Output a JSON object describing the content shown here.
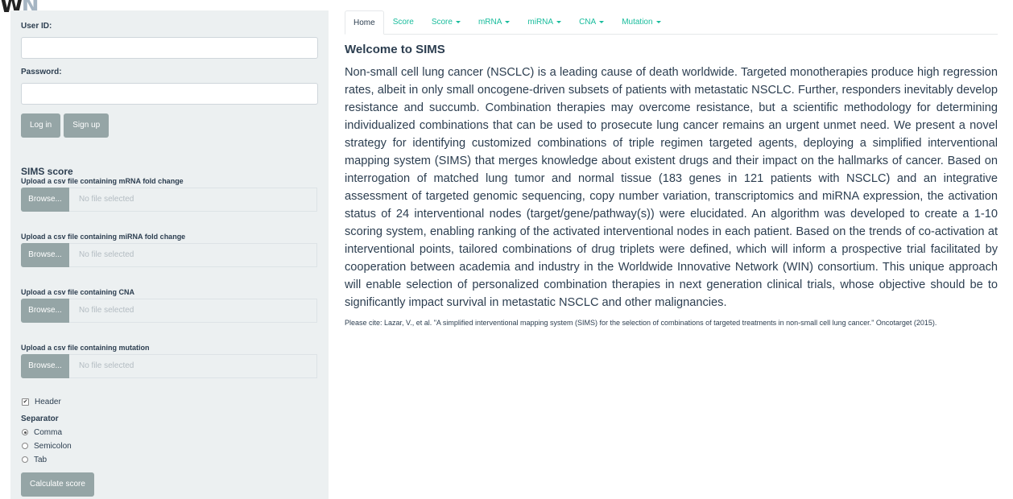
{
  "logo": {
    "letter1": "W",
    "letter2": "N"
  },
  "login": {
    "user_label": "User ID:",
    "user_value": "",
    "password_label": "Password:",
    "password_value": "",
    "login_button": "Log in",
    "signup_button": "Sign up"
  },
  "sims": {
    "section_title": "SIMS score",
    "uploads": [
      {
        "label": "Upload a csv file containing mRNA fold change",
        "browse": "Browse...",
        "file": "No file selected"
      },
      {
        "label": "Upload a csv file containing miRNA fold change",
        "browse": "Browse...",
        "file": "No file selected"
      },
      {
        "label": "Upload a csv file containing CNA",
        "browse": "Browse...",
        "file": "No file selected"
      },
      {
        "label": "Upload a csv file containing mutation",
        "browse": "Browse...",
        "file": "No file selected"
      }
    ],
    "header_label": "Header",
    "header_checked": true,
    "separator_title": "Separator",
    "separators": [
      {
        "label": "Comma",
        "selected": true
      },
      {
        "label": "Semicolon",
        "selected": false
      },
      {
        "label": "Tab",
        "selected": false
      }
    ],
    "calc_button": "Calculate score"
  },
  "tabs": [
    {
      "label": "Home",
      "active": true,
      "dropdown": false
    },
    {
      "label": "Score",
      "active": false,
      "dropdown": false
    },
    {
      "label": "Score",
      "active": false,
      "dropdown": true
    },
    {
      "label": "mRNA",
      "active": false,
      "dropdown": true
    },
    {
      "label": "miRNA",
      "active": false,
      "dropdown": true
    },
    {
      "label": "CNA",
      "active": false,
      "dropdown": true
    },
    {
      "label": "Mutation",
      "active": false,
      "dropdown": true
    }
  ],
  "colors": {
    "accent": "#18bc9c",
    "primary": "#2c3e50",
    "button": "#95a5a6",
    "sidebar_bg": "#ecf0f1"
  },
  "content": {
    "title": "Welcome to SIMS",
    "paragraph": "Non-small cell lung cancer (NSCLC) is a leading cause of death worldwide. Targeted monotherapies produce high regression rates, albeit in only small oncogene-driven subsets of patients with metastatic NSCLC. Further, responders inevitably develop resistance and succumb. Combination therapies may overcome resistance, but a scientific methodology for determining individualized combinations that can be used to prosecute lung cancer remains an urgent unmet need. We present a novel strategy for identifying customized combinations of triple regimen targeted agents, deploying a simplified interventional mapping system (SIMS) that merges knowledge about existent drugs and their impact on the hallmarks of cancer. Based on interrogation of matched lung tumor and normal tissue (183 genes in 121 patients with NSCLC) and an integrative assessment of targeted genomic sequencing, copy number variation, transcriptomics and miRNA expression, the activation status of 24 interventional nodes (target/gene/pathway(s)) were elucidated. An algorithm was developed to create a 1-10 scoring system, enabling ranking of the activated interventional nodes in each patient. Based on the trends of co-activation at interventional points, tailored combinations of drug triplets were defined, which will inform a prospective trial facilitated by cooperation between academia and industry in the Worldwide Innovative Network (WIN) consortium. This unique approach will enable selection of personalized combination therapies in next generation clinical trials, whose objective should be to significantly impact survival in metastatic NSCLC and other malignancies.",
    "citation": "Please cite: Lazar, V., et al. \"A simplified interventional mapping system (SIMS) for the selection of combinations of targeted treatments in non-small cell lung cancer.\" Oncotarget (2015)."
  }
}
